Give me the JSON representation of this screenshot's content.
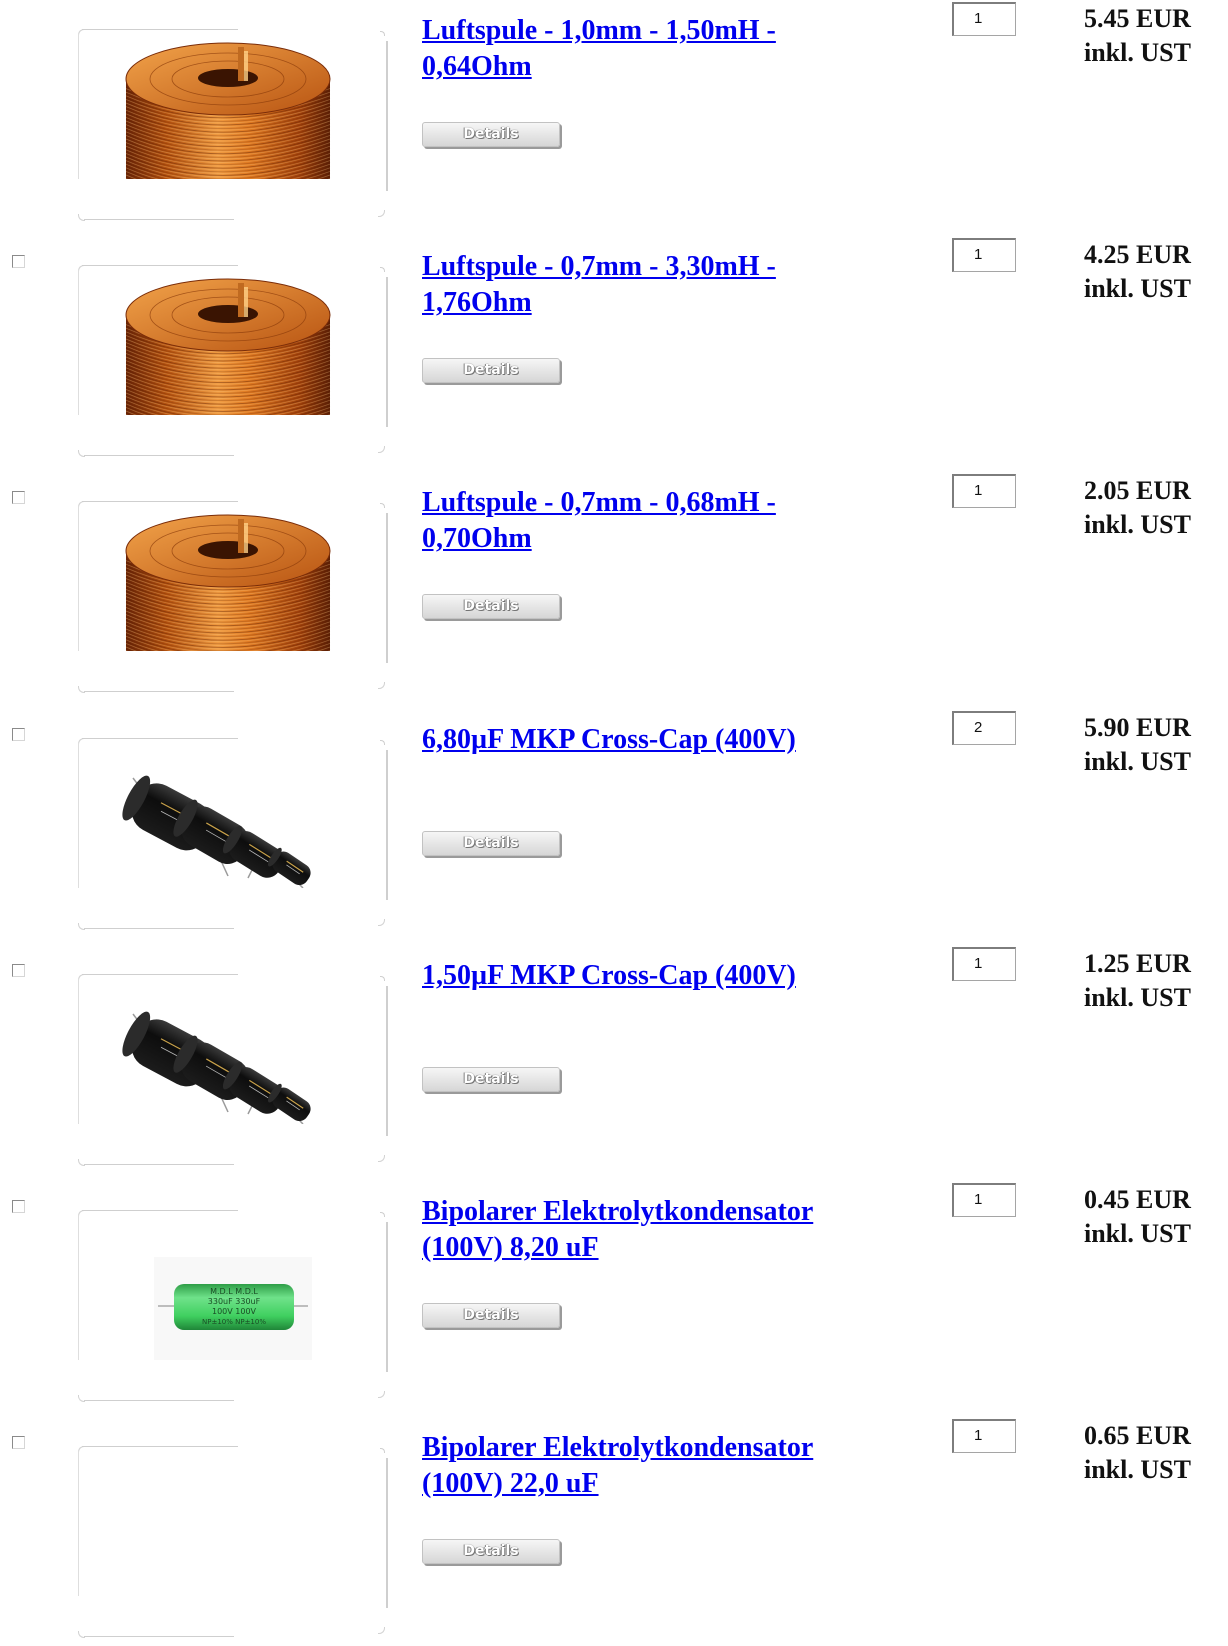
{
  "product_list": {
    "details_label": "Details",
    "items": [
      {
        "title": "Luftspule - 1,0mm - 1,50mH - 0,64Ohm",
        "qty": "1",
        "price": "5.45 EUR",
        "tax_note": "inkl. UST",
        "image": "air-core-coil"
      },
      {
        "title": "Luftspule - 0,7mm - 3,30mH - 1,76Ohm",
        "qty": "1",
        "price": "4.25 EUR",
        "tax_note": "inkl. UST",
        "image": "air-core-coil"
      },
      {
        "title": "Luftspule - 0,7mm - 0,68mH - 0,70Ohm",
        "qty": "1",
        "price": "2.05 EUR",
        "tax_note": "inkl. UST",
        "image": "air-core-coil"
      },
      {
        "title": "6,80µF MKP Cross-Cap (400V)",
        "qty": "2",
        "price": "5.90 EUR",
        "tax_note": "inkl. UST",
        "image": "film-capacitors"
      },
      {
        "title": "1,50µF MKP Cross-Cap (400V)",
        "qty": "1",
        "price": "1.25 EUR",
        "tax_note": "inkl. UST",
        "image": "film-capacitors"
      },
      {
        "title": "Bipolarer Elektrolytkondensator (100V) 8,20 uF",
        "qty": "1",
        "price": "0.45 EUR",
        "tax_note": "inkl. UST",
        "image": "green-electrolytic-capacitor"
      },
      {
        "title": "Bipolarer Elektrolytkondensator (100V) 22,0 uF",
        "qty": "1",
        "price": "0.65 EUR",
        "tax_note": "inkl. UST",
        "image": "none"
      }
    ]
  },
  "images": {
    "electrolytic_cap_label": [
      "M.D.L  M.D.L",
      "330uF  330uF",
      "100V  100V",
      "NP±10% NP±10%"
    ]
  },
  "colors": {
    "link": "#0000ee",
    "coil_copper": "#c8641c",
    "capacitor_green": "#3fcf5f",
    "capacitor_black": "#111111"
  }
}
